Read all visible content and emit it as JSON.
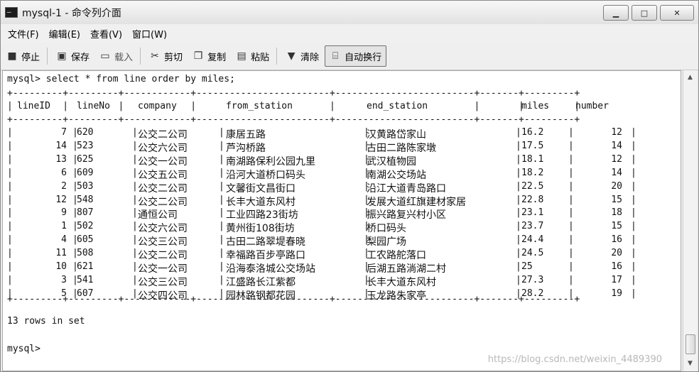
{
  "window": {
    "title": "mysql-1 - 命令列介面",
    "minimize": "▁",
    "maximize": "□",
    "close": "✕"
  },
  "menu": [
    "文件(F)",
    "编辑(E)",
    "查看(V)",
    "窗口(W)"
  ],
  "toolbar": {
    "stop": "停止",
    "save": "保存",
    "load": "载入",
    "cut": "剪切",
    "copy": "复制",
    "paste": "粘贴",
    "clear": "清除",
    "wrap": "自动换行"
  },
  "console": {
    "command": "mysql> select * from line order by miles;",
    "border": "+---------+---------+------------+------------------------+-------------------------+-------+---------+",
    "headers": [
      "lineID",
      "lineNo",
      "company",
      "from_station",
      "end_station",
      "miles",
      "number"
    ],
    "rows": [
      [
        "7",
        "620",
        "公交二公司",
        "康居五路",
        "汉黄路岱家山",
        "16.2",
        "12"
      ],
      [
        "14",
        "523",
        "公交六公司",
        "芦沟桥路",
        "古田二路陈家墩",
        "17.5",
        "14"
      ],
      [
        "13",
        "625",
        "公交一公司",
        "南湖路保利公园九里",
        "武汉植物园",
        "18.1",
        "12"
      ],
      [
        "6",
        "609",
        "公交五公司",
        "沿河大道桥口码头",
        "南湖公交场站",
        "18.2",
        "14"
      ],
      [
        "2",
        "503",
        "公交二公司",
        "文馨街文昌街口",
        "沿江大道青岛路口",
        "22.5",
        "20"
      ],
      [
        "12",
        "548",
        "公交二公司",
        "长丰大道东风村",
        "发展大道红旗建材家居",
        "22.8",
        "15"
      ],
      [
        "9",
        "807",
        "通恒公司",
        "工业四路23街坊",
        "振兴路复兴村小区",
        "23.1",
        "18"
      ],
      [
        "1",
        "502",
        "公交六公司",
        "黄州街108街坊",
        "桥口码头",
        "23.7",
        "15"
      ],
      [
        "4",
        "605",
        "公交三公司",
        "古田二路翠堤春晓",
        "梨园广场",
        "24.4",
        "16"
      ],
      [
        "11",
        "508",
        "公交二公司",
        "幸福路百步亭路口",
        "工农路舵落口",
        "24.5",
        "20"
      ],
      [
        "10",
        "621",
        "公交一公司",
        "沿海泰洛城公交场站",
        "后湖五路淌湖二村",
        "25",
        "16"
      ],
      [
        "3",
        "541",
        "公交三公司",
        "江盛路长江紫都",
        "长丰大道东风村",
        "27.3",
        "17"
      ],
      [
        "5",
        "607",
        "公交四公司",
        "园林路钢都花园",
        "玉龙路朱家亭",
        "28.2",
        "19"
      ]
    ],
    "rowcount": "13 rows in set",
    "prompt": "mysql>"
  },
  "watermark": "https://blog.csdn.net/weixin_4489390"
}
